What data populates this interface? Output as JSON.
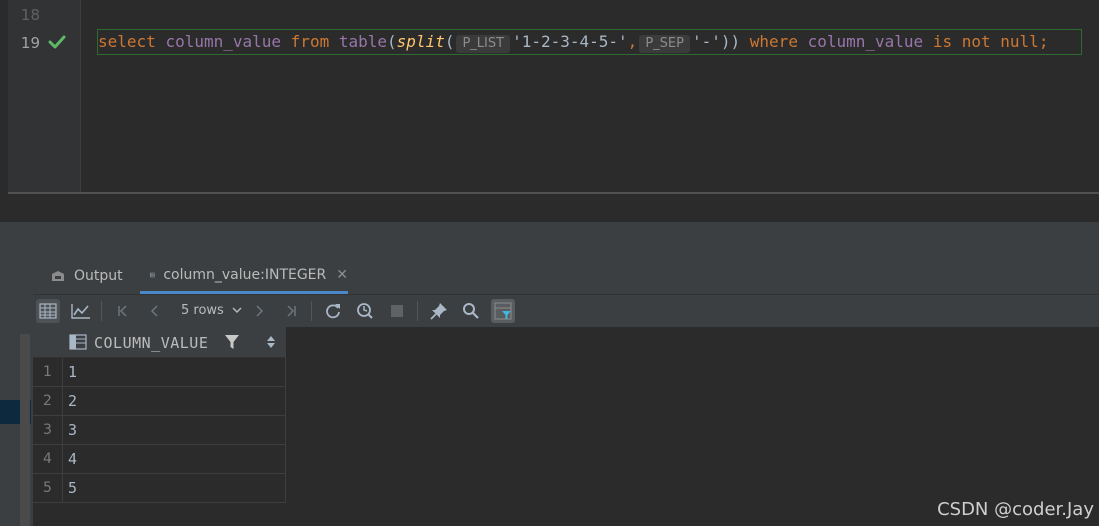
{
  "editor": {
    "line_numbers": [
      "18",
      "19"
    ],
    "code": {
      "kw_select": "select",
      "col1": "column_value",
      "kw_from": "from",
      "kw_table": "table",
      "paren_open": "(",
      "fn_split": "split",
      "paren_open2": "(",
      "hint_plist": "P_LIST",
      "str1": "'1-2-3-4-5-'",
      "comma": ",",
      "hint_psep": "P_SEP",
      "str2": "'-'",
      "paren_close": "))",
      "kw_where": "where",
      "col2": "column_value",
      "kw_is": "is",
      "kw_not": "not",
      "kw_null": "null",
      "semicolon": ";"
    }
  },
  "tabs": [
    {
      "label": "Output"
    },
    {
      "label": "column_value:INTEGER",
      "close": "✕"
    }
  ],
  "toolbar": {
    "rows_label": "5 rows"
  },
  "grid": {
    "column_header": "COLUMN_VALUE",
    "rows": [
      {
        "num": "1",
        "value": "1"
      },
      {
        "num": "2",
        "value": "2"
      },
      {
        "num": "3",
        "value": "3"
      },
      {
        "num": "4",
        "value": "4"
      },
      {
        "num": "5",
        "value": "5"
      }
    ]
  },
  "watermark": "CSDN @coder.Jay",
  "colors": {
    "accent": "#4a88c7",
    "keyword": "#cc7832",
    "identifier": "#9876aa",
    "function": "#ffc66d",
    "success": "#5fb865"
  }
}
